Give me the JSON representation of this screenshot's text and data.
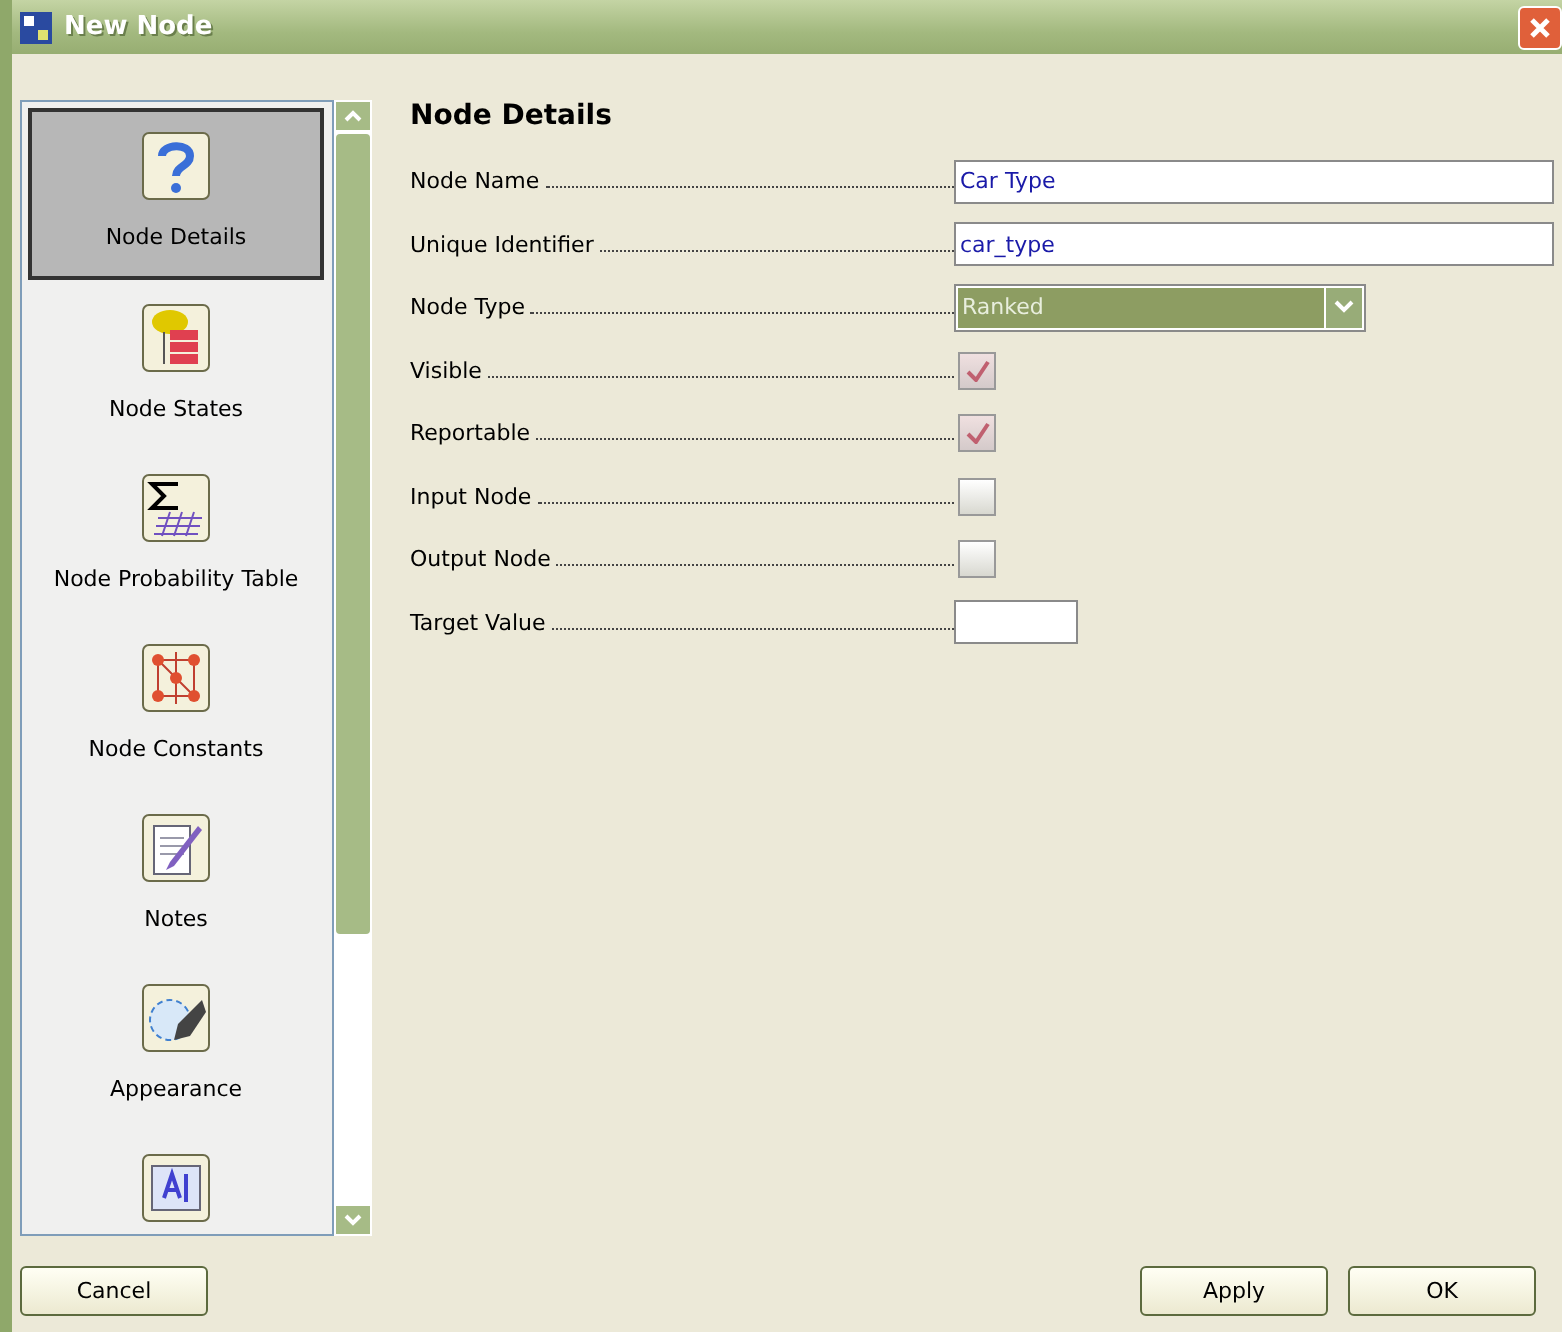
{
  "window": {
    "title": "New Node"
  },
  "sidebar": {
    "items": [
      {
        "label": "Node Details",
        "selected": true
      },
      {
        "label": "Node States",
        "selected": false
      },
      {
        "label": "Node Probability Table",
        "selected": false
      },
      {
        "label": "Node Constants",
        "selected": false
      },
      {
        "label": "Notes",
        "selected": false
      },
      {
        "label": "Appearance",
        "selected": false
      },
      {
        "selected": false
      }
    ]
  },
  "panel": {
    "heading": "Node Details",
    "fields": [
      {
        "kind": "text",
        "label": "Node Name",
        "value": "Car Type"
      },
      {
        "kind": "text",
        "label": "Unique Identifier",
        "value": "car_type"
      },
      {
        "kind": "dropdown",
        "label": "Node Type",
        "value": "Ranked"
      },
      {
        "kind": "checkbox",
        "label": "Visible",
        "checked": true,
        "disabled": true
      },
      {
        "kind": "checkbox",
        "label": "Reportable",
        "checked": true,
        "disabled": true
      },
      {
        "kind": "checkbox",
        "label": "Input Node",
        "checked": false,
        "disabled": false
      },
      {
        "kind": "checkbox",
        "label": "Output Node",
        "checked": false,
        "disabled": false
      },
      {
        "kind": "short-text",
        "label": "Target Value"
      }
    ]
  },
  "buttons": {
    "left": [
      "Cancel"
    ],
    "right": [
      "Apply",
      "OK"
    ]
  }
}
